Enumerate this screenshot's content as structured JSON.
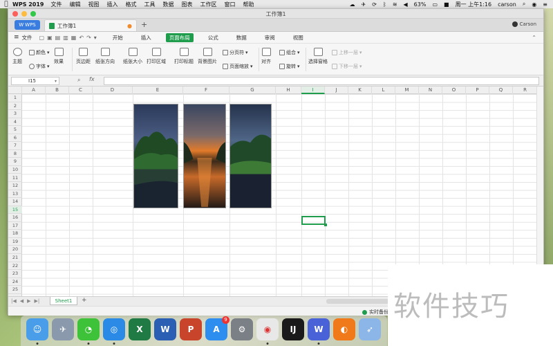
{
  "menubar": {
    "app_name": "WPS 2019",
    "items": [
      "文件",
      "编辑",
      "视图",
      "插入",
      "格式",
      "工具",
      "数据",
      "图表",
      "工作区",
      "窗口",
      "帮助"
    ],
    "battery": "63%",
    "clock": "周一 上午1:16",
    "user": "carson"
  },
  "window": {
    "title": "工作簿1",
    "wps_tab": "WPS",
    "doc_tab": "工作簿1",
    "account": "Carson"
  },
  "menu_row": {
    "file_label": "文件",
    "tabs": [
      "开始",
      "插入",
      "页面布局",
      "公式",
      "数据",
      "审阅",
      "视图"
    ],
    "active_tab": "页面布局"
  },
  "ribbon": {
    "theme": "主题",
    "color": "颜色",
    "font": "字体",
    "effect": "效果",
    "margin": "页边距",
    "orientation": "纸张方向",
    "size": "纸张大小",
    "print_area": "打印区域",
    "print_titles": "打印标题",
    "background": "背景图片",
    "page_break": "分页符",
    "page_zoom": "页面缩放",
    "align": "对齐",
    "group": "组合",
    "rotate": "旋转",
    "selection_pane": "选择窗格",
    "bring_forward": "上移一层",
    "send_backward": "下移一层"
  },
  "formula_bar": {
    "name_box": "I15",
    "fx": "fx",
    "value": ""
  },
  "grid": {
    "columns": [
      "A",
      "B",
      "C",
      "D",
      "E",
      "F",
      "G",
      "H",
      "I",
      "J",
      "K",
      "L",
      "M",
      "N",
      "O",
      "P",
      "Q",
      "R"
    ],
    "rows": [
      "1",
      "2",
      "3",
      "4",
      "5",
      "6",
      "7",
      "8",
      "9",
      "10",
      "11",
      "12",
      "13",
      "14",
      "15",
      "16",
      "17",
      "18",
      "19",
      "20",
      "21",
      "22",
      "23",
      "24",
      "25"
    ],
    "selected_column": "I",
    "selected_row": "15"
  },
  "sheet_bar": {
    "sheet": "Sheet1",
    "add": "+"
  },
  "status": {
    "backup": "实时备份"
  },
  "dock": {
    "badge_count": "9"
  },
  "watermark": "软件技巧",
  "colors": {
    "accent": "#1f9d4d",
    "wps_blue": "#3a7de0"
  }
}
